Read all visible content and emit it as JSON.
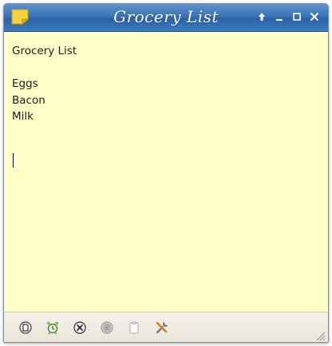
{
  "window": {
    "title": "Grocery List"
  },
  "titlebar": {
    "app_icon": "sticky-note-icon",
    "controls": [
      {
        "name": "keep-above-icon"
      },
      {
        "name": "minimize-icon"
      },
      {
        "name": "maximize-icon"
      },
      {
        "name": "close-icon"
      }
    ]
  },
  "note": {
    "text": "Grocery List\n\nEggs\nBacon\nMilk\n"
  },
  "toolbar": {
    "buttons": [
      {
        "icon": "new-note-icon"
      },
      {
        "icon": "alarm-icon"
      },
      {
        "icon": "delete-note-icon"
      },
      {
        "icon": "color-icon"
      },
      {
        "icon": "clipboard-icon"
      },
      {
        "icon": "settings-tools-icon"
      }
    ]
  },
  "colors": {
    "note_background": "#ffffc8",
    "titlebar": "#3a73b6",
    "toolbar": "#ece8dc",
    "text": "#1c1c1c"
  }
}
